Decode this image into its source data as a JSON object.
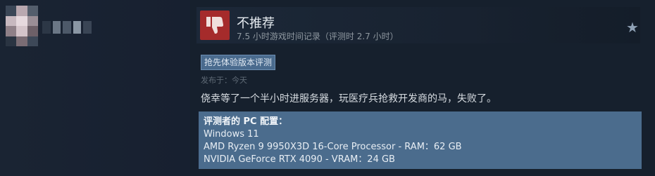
{
  "review": {
    "rating": "不推荐",
    "hours": "7.5 小时游戏时间记录（评测时 2.7 小时）",
    "badge": "抢先体验版本评测",
    "posted": "发布于：今天",
    "text": "侥幸等了一个半小时进服务器，玩医疗兵抢救开发商的马，失败了。",
    "specs": {
      "title": "评测者的 PC 配置：",
      "os": "Windows 11",
      "cpu": "AMD Ryzen 9 9950X3D 16-Core Processor - RAM：62 GB",
      "gpu": "NVIDIA GeForce RTX 4090 - VRAM：24 GB"
    }
  },
  "icons": {
    "thumb": "thumbs-down-icon",
    "star": "star-icon"
  },
  "colors": {
    "background": "#16202d",
    "thumb_bg": "#a52b2b",
    "badge_bg": "#4a6b8e",
    "specs_bg": "#4b6c8d"
  }
}
